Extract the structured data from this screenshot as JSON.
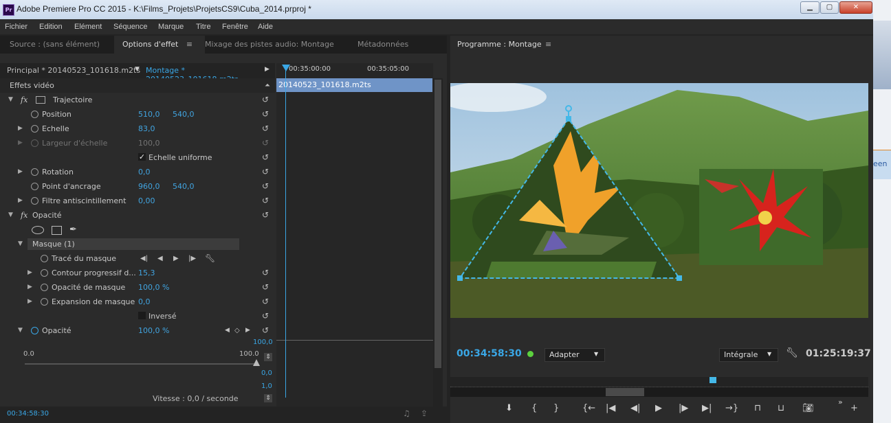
{
  "window": {
    "title": "Adobe Premiere Pro CC 2015 - K:\\Films_Projets\\ProjetsCS9\\Cuba_2014.prproj *",
    "app_icon": "Pr"
  },
  "menu": [
    "Fichier",
    "Edition",
    "Elément",
    "Séquence",
    "Marque",
    "Titre",
    "Fenêtre",
    "Aide"
  ],
  "left_tabs": [
    "Source : (sans élément)",
    "Options d'effet",
    "Mixage des pistes audio: Montage",
    "Métadonnées"
  ],
  "effect_controls": {
    "clip_source": "Principal * 20140523_101618.m2ts",
    "clip_sequence": "Montage * 20140523_101618.m2ts",
    "section": "Effets vidéo",
    "timeline_clip": "20140523_101618.m2ts",
    "time_a": "00:35:00:00",
    "time_b": "00:35:05:00",
    "motion": "Trajectoire",
    "position_label": "Position",
    "position_x": "510,0",
    "position_y": "540,0",
    "scale_label": "Echelle",
    "scale": "83,0",
    "scale_width_label": "Largeur d'échelle",
    "scale_width": "100,0",
    "uniform_label": "Echelle uniforme",
    "rotation_label": "Rotation",
    "rotation": "0,0",
    "anchor_label": "Point d'ancrage",
    "anchor_x": "960,0",
    "anchor_y": "540,0",
    "antiflicker_label": "Filtre antiscintillement",
    "antiflicker": "0,00",
    "opacity_section": "Opacité",
    "mask": "Masque (1)",
    "mask_path": "Tracé du masque",
    "mask_feather_label": "Contour progressif d...",
    "mask_feather": "15,3",
    "mask_opacity_label": "Opacité de masque",
    "mask_opacity": "100,0 %",
    "mask_expansion_label": "Expansion de masque",
    "mask_expansion": "0,0",
    "inverted_label": "Inversé",
    "opacity_label": "Opacité",
    "opacity": "100,0 %",
    "graph_max": "100,0",
    "graph_zero": "0,0",
    "graph_one": "1,0",
    "slider_min": "0.0",
    "slider_max": "100.0",
    "velocity": "Vitesse : 0,0 / seconde",
    "current_time": "00:34:58:30"
  },
  "program": {
    "title": "Programme : Montage",
    "timecode": "00:34:58:30",
    "fit": "Adapter",
    "quality": "Intégrale",
    "duration": "01:25:19:37"
  },
  "desktop_tab_text": "een",
  "colors": {
    "accent": "#3aa7e6",
    "panel": "#2b2b2b",
    "clip": "#6f94c7"
  }
}
